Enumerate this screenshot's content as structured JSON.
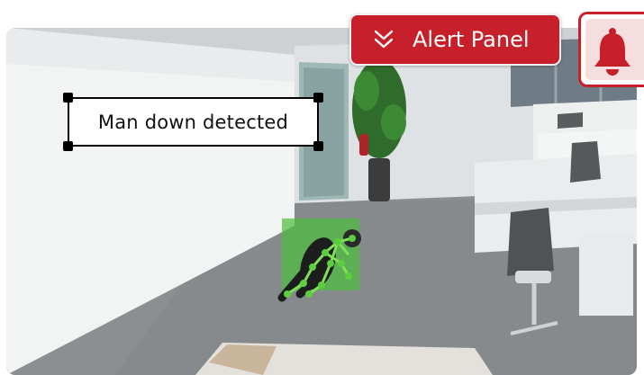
{
  "annotation": {
    "label": "Man down detected"
  },
  "alert_panel": {
    "label": "Alert Panel",
    "icon": "double-chevron-down-icon"
  },
  "bell": {
    "icon": "bell-icon"
  },
  "colors": {
    "accent": "#c8202a",
    "accent_light": "#f6dede",
    "detection_box": "#4cbe3c",
    "skeleton": "#7fe05a"
  }
}
